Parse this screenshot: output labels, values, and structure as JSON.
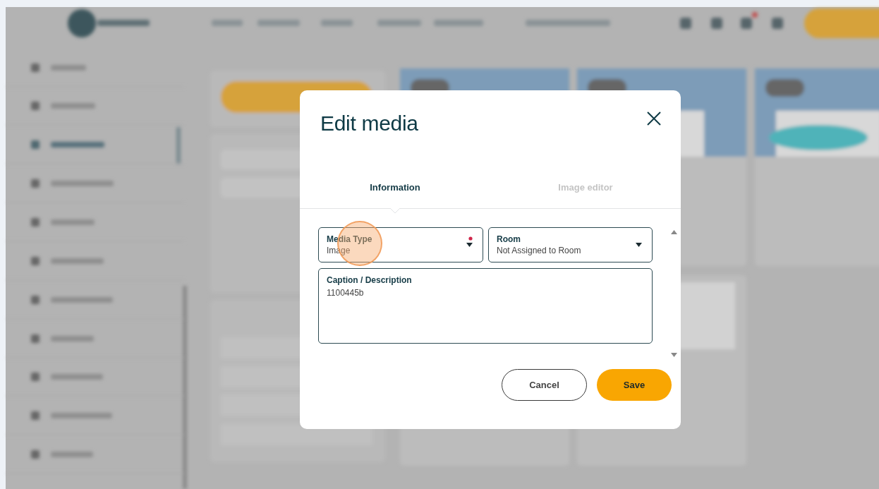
{
  "modal": {
    "title": "Edit media",
    "tabs": [
      {
        "label": "Information",
        "selected": true
      },
      {
        "label": "Image editor",
        "selected": false
      }
    ],
    "fields": [
      {
        "kind": "select",
        "label": "Media Type",
        "value": "Image",
        "required": true
      },
      {
        "kind": "select",
        "label": "Room",
        "value": "Not Assigned to Room",
        "required": false
      },
      {
        "kind": "textarea",
        "label": "Caption / Description",
        "value": "1100445b",
        "required": false
      }
    ],
    "buttons": [
      {
        "kind": "secondary",
        "label": "Cancel"
      },
      {
        "kind": "primary",
        "label": "Save"
      }
    ]
  }
}
